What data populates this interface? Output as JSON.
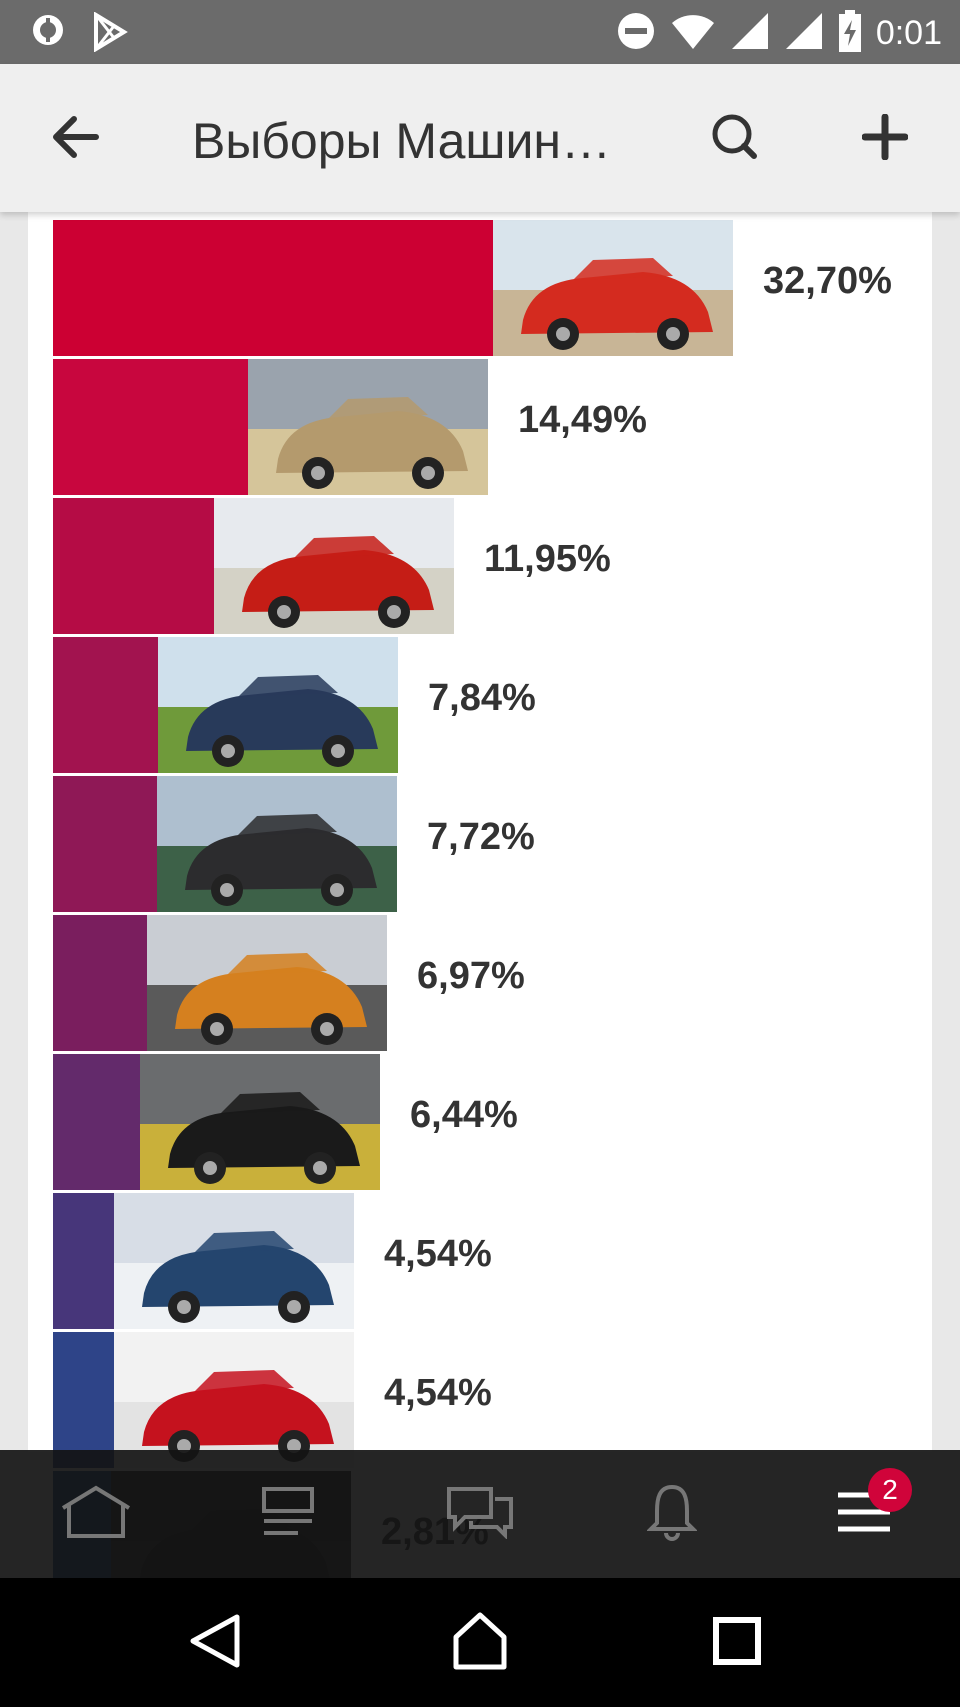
{
  "status_bar": {
    "time": "0:01",
    "icons": [
      "android-debug-icon",
      "play-store-icon",
      "do-not-disturb-icon",
      "wifi-icon",
      "signal-icon",
      "signal-icon",
      "battery-charging-icon"
    ]
  },
  "app_bar": {
    "title": "Выборы Машин…",
    "back_icon": "arrow-back-icon",
    "search_icon": "search-icon",
    "add_icon": "plus-icon"
  },
  "poll": {
    "results": [
      {
        "label": "32,70%",
        "value": 32.7,
        "color": "#cc0033",
        "photo": "red-coupe-photo"
      },
      {
        "label": "14,49%",
        "value": 14.49,
        "color": "#c8063e",
        "photo": "pickup-truck-photo"
      },
      {
        "label": "11,95%",
        "value": 11.95,
        "color": "#b50c45",
        "photo": "red-sedan-photo"
      },
      {
        "label": "7,84%",
        "value": 7.84,
        "color": "#a2134f",
        "photo": "suv-and-tank-photo"
      },
      {
        "label": "7,72%",
        "value": 7.72,
        "color": "#8f1856",
        "photo": "wagon-mountains-photo"
      },
      {
        "label": "6,97%",
        "value": 6.97,
        "color": "#7a1e5e",
        "photo": "orange-crossover-photo"
      },
      {
        "label": "6,44%",
        "value": 6.44,
        "color": "#632a6b",
        "photo": "black-sedan-photo"
      },
      {
        "label": "4,54%",
        "value": 4.54,
        "color": "#47367a",
        "photo": "blue-suv-woman-photo"
      },
      {
        "label": "4,54%",
        "value": 4.54,
        "color": "#2e4488",
        "photo": "red-sportscar-photo"
      },
      {
        "label": "2,81%",
        "value": 2.81,
        "color": "#1a4f92",
        "photo": "dark-car-photo"
      }
    ]
  },
  "bottom_nav": {
    "items": [
      "home-icon",
      "feed-icon",
      "messages-icon",
      "notifications-icon",
      "menu-icon"
    ],
    "menu_badge": "2"
  },
  "system_nav": {
    "items": [
      "back-triangle-icon",
      "home-circle-icon",
      "recents-square-icon"
    ]
  }
}
